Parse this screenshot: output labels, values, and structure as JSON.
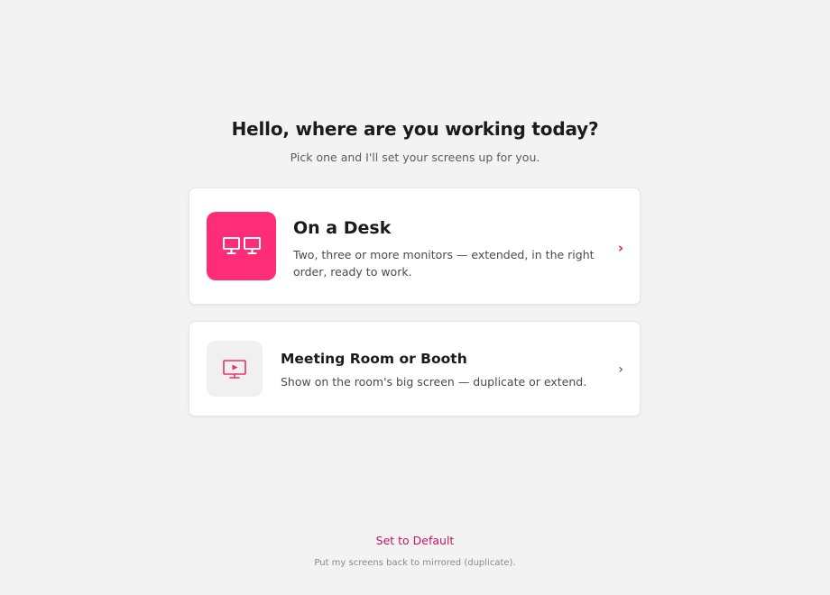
{
  "header": {
    "title": "Hello, where are you working today?",
    "subtitle": "Pick one and I'll set your screens up for you."
  },
  "options": [
    {
      "title": "On a Desk",
      "description": "Two, three or more monitors — extended, in the right order, ready to work.",
      "icon": "dual-monitor-icon",
      "accent_color": "#ff2d78",
      "chevron": "›"
    },
    {
      "title": "Meeting Room or Booth",
      "description": "Show on the room's big screen — duplicate or extend.",
      "icon": "presentation-screen-icon",
      "accent_color": "#e8336d",
      "chevron": "›"
    }
  ],
  "footer": {
    "default_label": "Set to Default",
    "default_note": "Put my screens back to mirrored (duplicate).",
    "link_color": "#c2185b"
  }
}
